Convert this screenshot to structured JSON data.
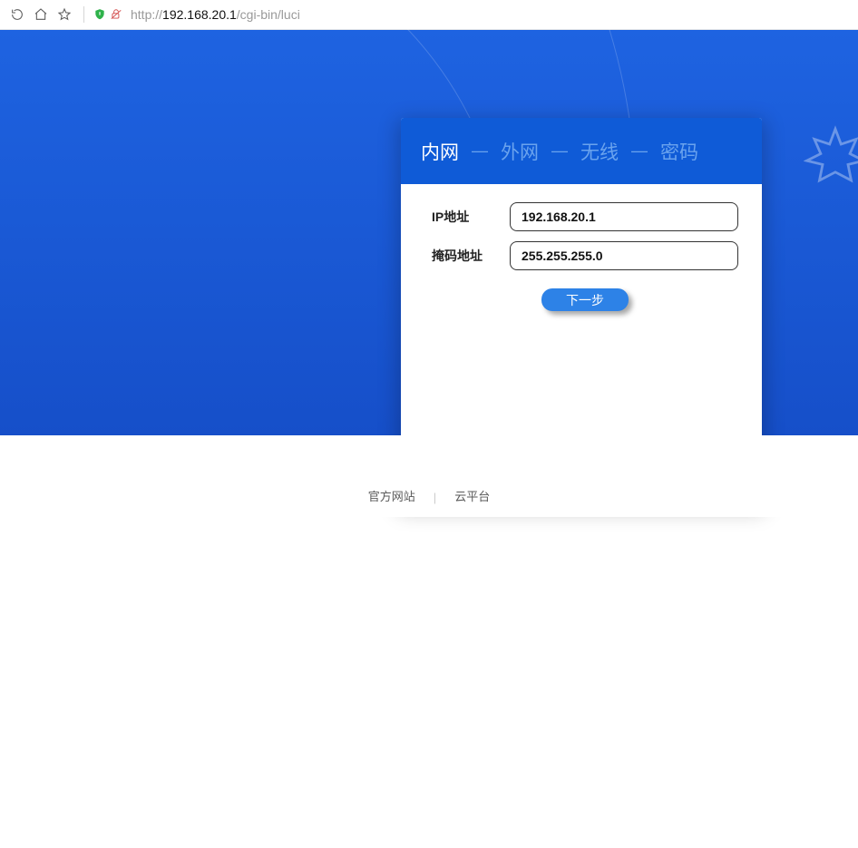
{
  "urlbar": {
    "scheme": "http://",
    "host": "192.168.20.1",
    "path": "/cgi-bin/luci"
  },
  "tabs": {
    "items": [
      {
        "label": "内网",
        "active": true
      },
      {
        "label": "外网",
        "active": false
      },
      {
        "label": "无线",
        "active": false
      },
      {
        "label": "密码",
        "active": false
      }
    ]
  },
  "form": {
    "ip_label": "IP地址",
    "ip_value": "192.168.20.1",
    "mask_label": "掩码地址",
    "mask_value": "255.255.255.0",
    "next_button": "下一步"
  },
  "footer": {
    "link1": "官方网站",
    "link2": "云平台"
  }
}
